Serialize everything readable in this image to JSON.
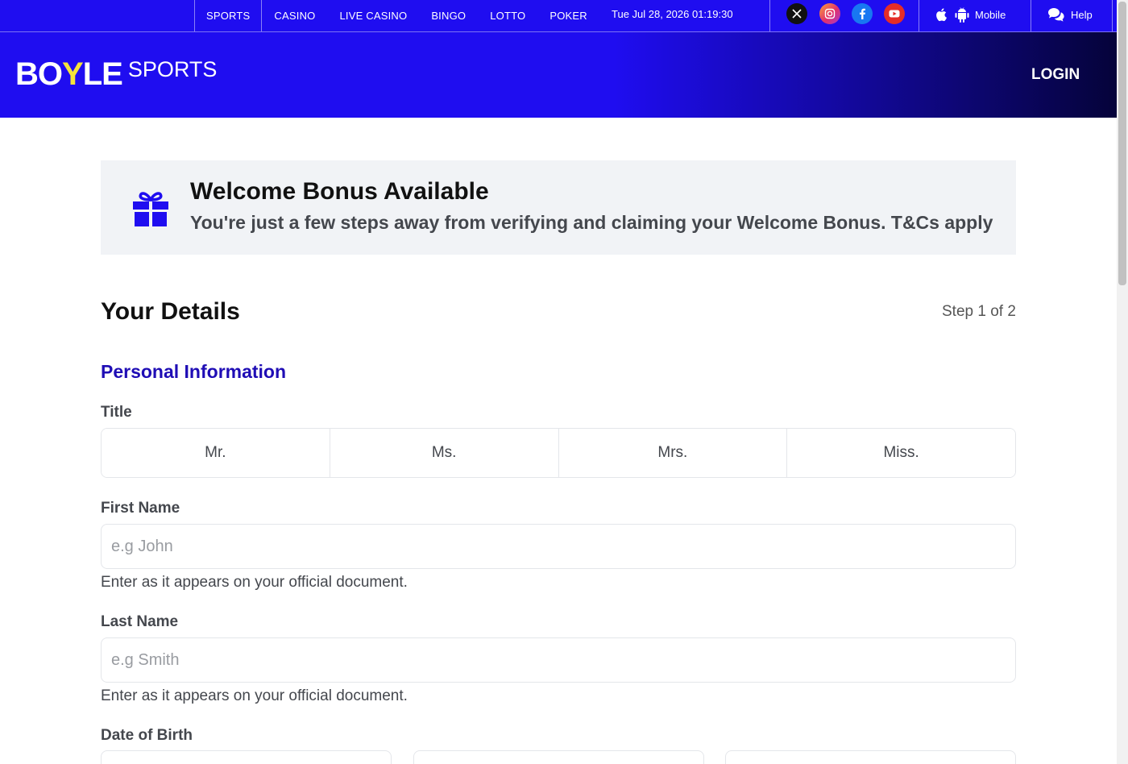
{
  "topbar": {
    "nav": [
      "SPORTS",
      "CASINO",
      "LIVE CASINO",
      "BINGO",
      "LOTTO",
      "POKER"
    ],
    "datetime": "Tue Jul 28, 2026 01:19:30",
    "social": [
      "x-icon",
      "instagram-icon",
      "facebook-icon",
      "youtube-icon"
    ],
    "mobile_label": "Mobile",
    "help_label": "Help"
  },
  "header": {
    "logo_main_a": "BO",
    "logo_main_y": "Y",
    "logo_main_b": "LE",
    "logo_sub": "SPORTS",
    "login_label": "LOGIN"
  },
  "banner": {
    "icon": "gift-icon",
    "title": "Welcome Bonus Available",
    "text": "You're just a few steps away from verifying and claiming your Welcome Bonus. T&Cs apply"
  },
  "form": {
    "section_title": "Your Details",
    "step": "Step 1 of 2",
    "subheading": "Personal Information",
    "title_label": "Title",
    "title_options": [
      "Mr.",
      "Ms.",
      "Mrs.",
      "Miss."
    ],
    "first_name_label": "First Name",
    "first_name_placeholder": "e.g John",
    "first_name_hint": "Enter as it appears on your official document.",
    "last_name_label": "Last Name",
    "last_name_placeholder": "e.g Smith",
    "last_name_hint": "Enter as it appears on your official document.",
    "dob_label": "Date of Birth"
  },
  "colors": {
    "brand_blue": "#1f0df0",
    "heading_blue": "#1f0db5",
    "logo_accent": "#f5e43a"
  }
}
